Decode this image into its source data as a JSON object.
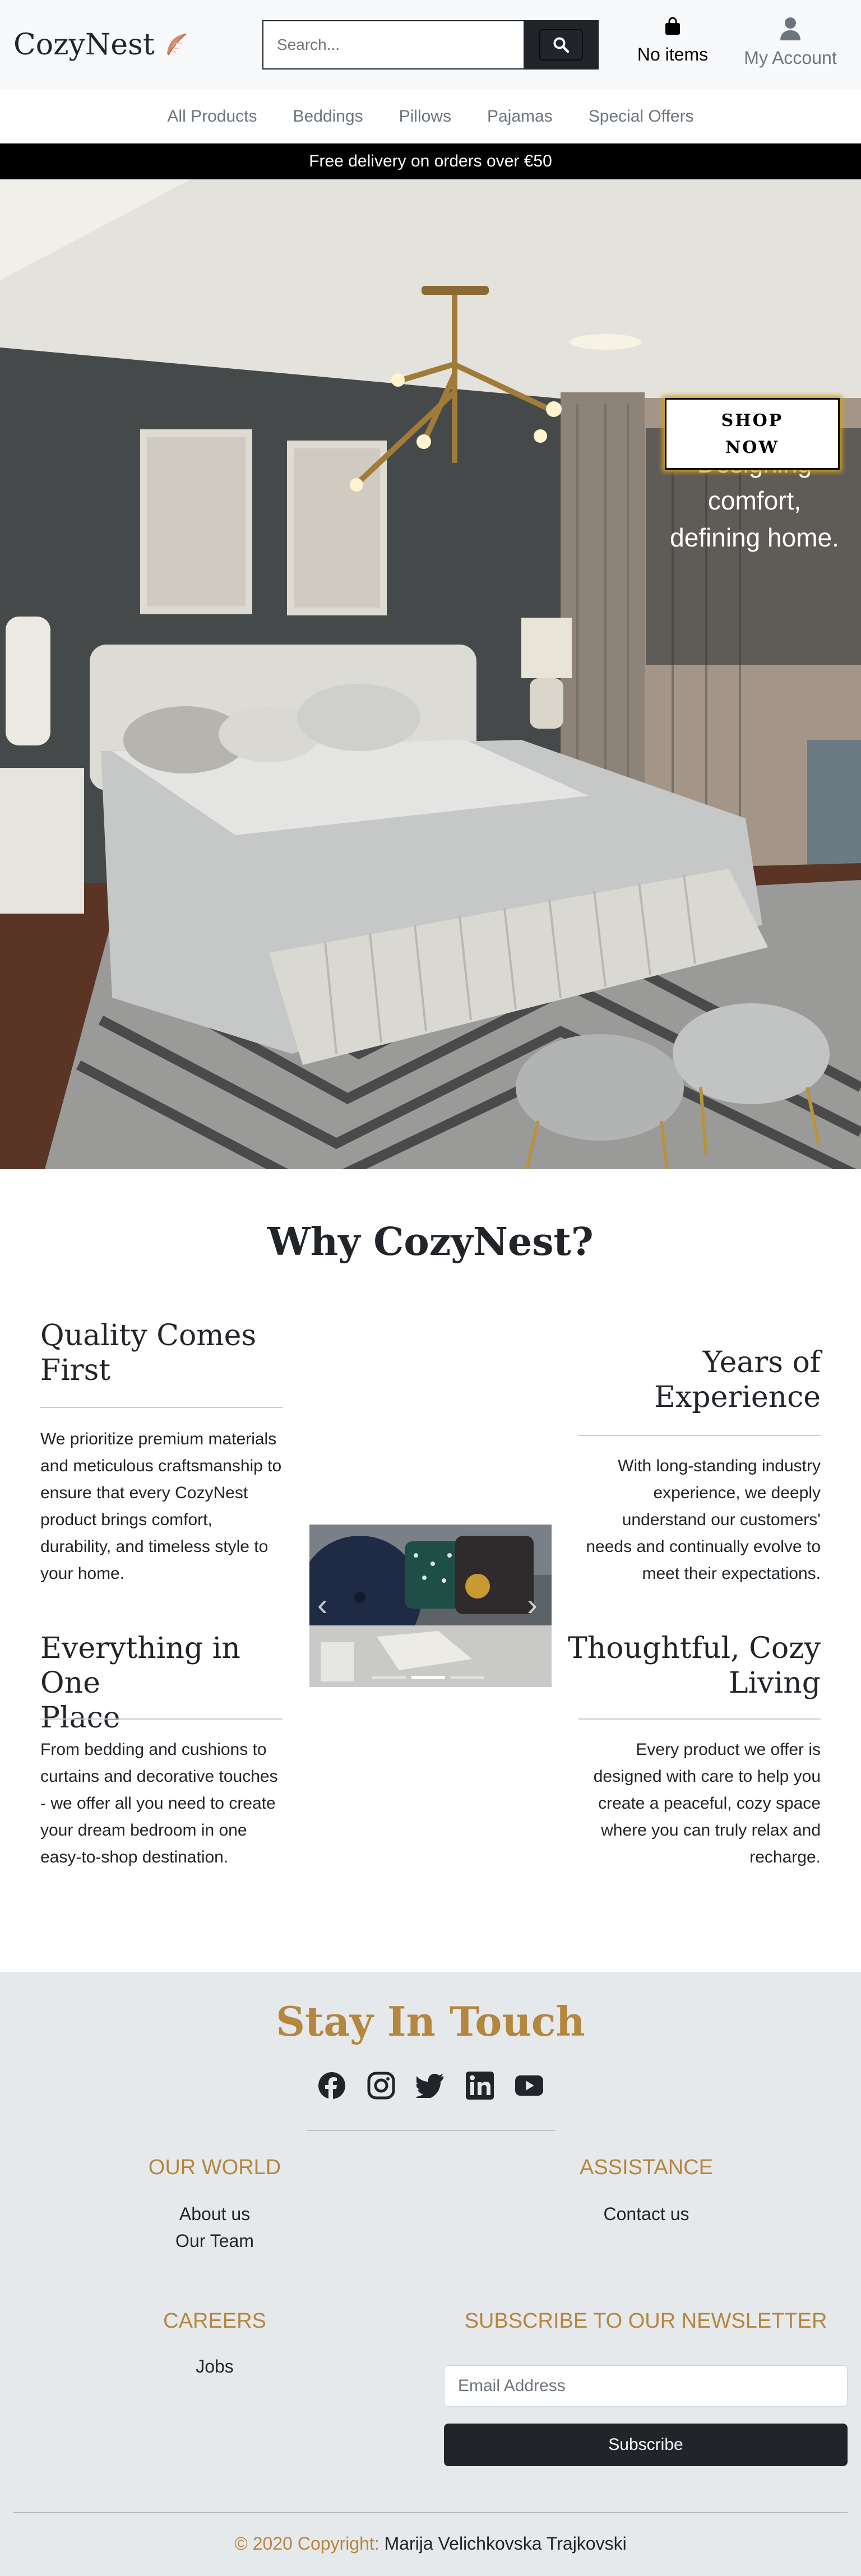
{
  "header": {
    "logo_text": "CozyNest",
    "logo_icon": "feather-icon",
    "search": {
      "placeholder": "Search..."
    },
    "cart_label": "No items",
    "account_label": "My Account"
  },
  "nav": {
    "items": [
      {
        "label": "All Products"
      },
      {
        "label": "Beddings"
      },
      {
        "label": "Pillows"
      },
      {
        "label": "Pajamas"
      },
      {
        "label": "Special Offers"
      }
    ]
  },
  "banner": {
    "text": "Free delivery on orders over €50"
  },
  "hero": {
    "tagline_1": "Designing",
    "tagline_2": "comfort,",
    "tagline_3": "defining home.",
    "cta_1": "SHOP",
    "cta_2": "NOW"
  },
  "why": {
    "title": "Why CozyNest?",
    "features": [
      {
        "title_1": "Quality Comes",
        "title_2": "First",
        "text": "We prioritize premium materials and meticulous craftsmanship to ensure that every CozyNest product brings comfort, durability, and timeless style to your home."
      },
      {
        "title_1": "Years of",
        "title_2": "Experience",
        "text": "With long-standing industry experience, we deeply understand our customers' needs and continually evolve to meet their expectations."
      },
      {
        "title_1": "Everything in One",
        "title_2": "Place",
        "text": "From bedding and cushions to curtains and decorative touches - we offer all you need to create your dream bedroom in one easy-to-shop destination."
      },
      {
        "title_1": "Thoughtful, Cozy",
        "title_2": "Living",
        "text": "Every product we offer is designed with care to help you create a peaceful, cozy space where you can truly relax and recharge."
      }
    ],
    "carousel": {
      "prev": "‹",
      "next": "›",
      "slides": 3,
      "active": 1
    }
  },
  "footer": {
    "stay_title": "Stay In Touch",
    "socials": [
      "facebook-icon",
      "instagram-icon",
      "twitter-icon",
      "linkedin-icon",
      "youtube-icon"
    ],
    "our_world": {
      "heading": "OUR WORLD",
      "links": [
        "About us",
        "Our Team"
      ]
    },
    "assistance": {
      "heading": "ASSISTANCE",
      "links": [
        "Contact us"
      ]
    },
    "careers": {
      "heading": "CAREERS",
      "links": [
        "Jobs"
      ]
    },
    "newsletter": {
      "heading": "SUBSCRIBE TO OUR NEWSLETTER",
      "email_placeholder": "Email Address",
      "button": "Subscribe"
    },
    "copyright_prefix": "© 2020 Copyright:",
    "copyright_name": "Marija Velichkovska Trajkovski"
  },
  "colors": {
    "accent_gold": "#b5863e",
    "dark": "#212529",
    "footer_bg": "#e6e9ec",
    "header_bg": "#f8f9fa"
  }
}
